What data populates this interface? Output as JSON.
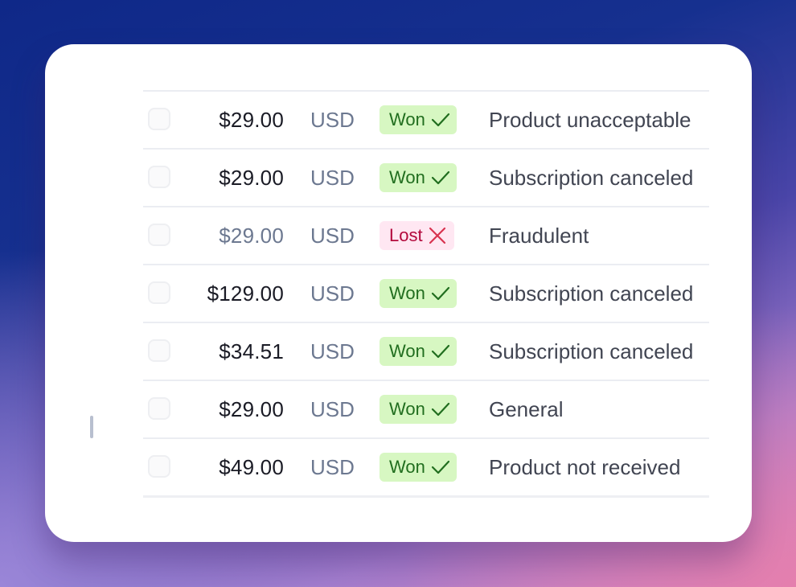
{
  "table": {
    "rows": [
      {
        "amount": "$29.00",
        "currency": "USD",
        "status": "Won",
        "status_type": "won",
        "status_icon": "checkmark-icon",
        "reason": "Product unacceptable",
        "muted": false
      },
      {
        "amount": "$29.00",
        "currency": "USD",
        "status": "Won",
        "status_type": "won",
        "status_icon": "checkmark-icon",
        "reason": "Subscription canceled",
        "muted": false
      },
      {
        "amount": "$29.00",
        "currency": "USD",
        "status": "Lost",
        "status_type": "lost",
        "status_icon": "x-mark-icon",
        "reason": "Fraudulent",
        "muted": true
      },
      {
        "amount": "$129.00",
        "currency": "USD",
        "status": "Won",
        "status_type": "won",
        "status_icon": "checkmark-icon",
        "reason": "Subscription canceled",
        "muted": false
      },
      {
        "amount": "$34.51",
        "currency": "USD",
        "status": "Won",
        "status_type": "won",
        "status_icon": "checkmark-icon",
        "reason": "Subscription canceled",
        "muted": false
      },
      {
        "amount": "$29.00",
        "currency": "USD",
        "status": "Won",
        "status_type": "won",
        "status_icon": "checkmark-icon",
        "reason": "General",
        "muted": false
      },
      {
        "amount": "$49.00",
        "currency": "USD",
        "status": "Won",
        "status_type": "won",
        "status_icon": "checkmark-icon",
        "reason": "Product not received",
        "muted": false
      }
    ]
  },
  "colors": {
    "won_bg": "#d7f7c2",
    "won_text": "#216e1f",
    "lost_bg": "#ffe7f2",
    "lost_text": "#b3093c"
  }
}
